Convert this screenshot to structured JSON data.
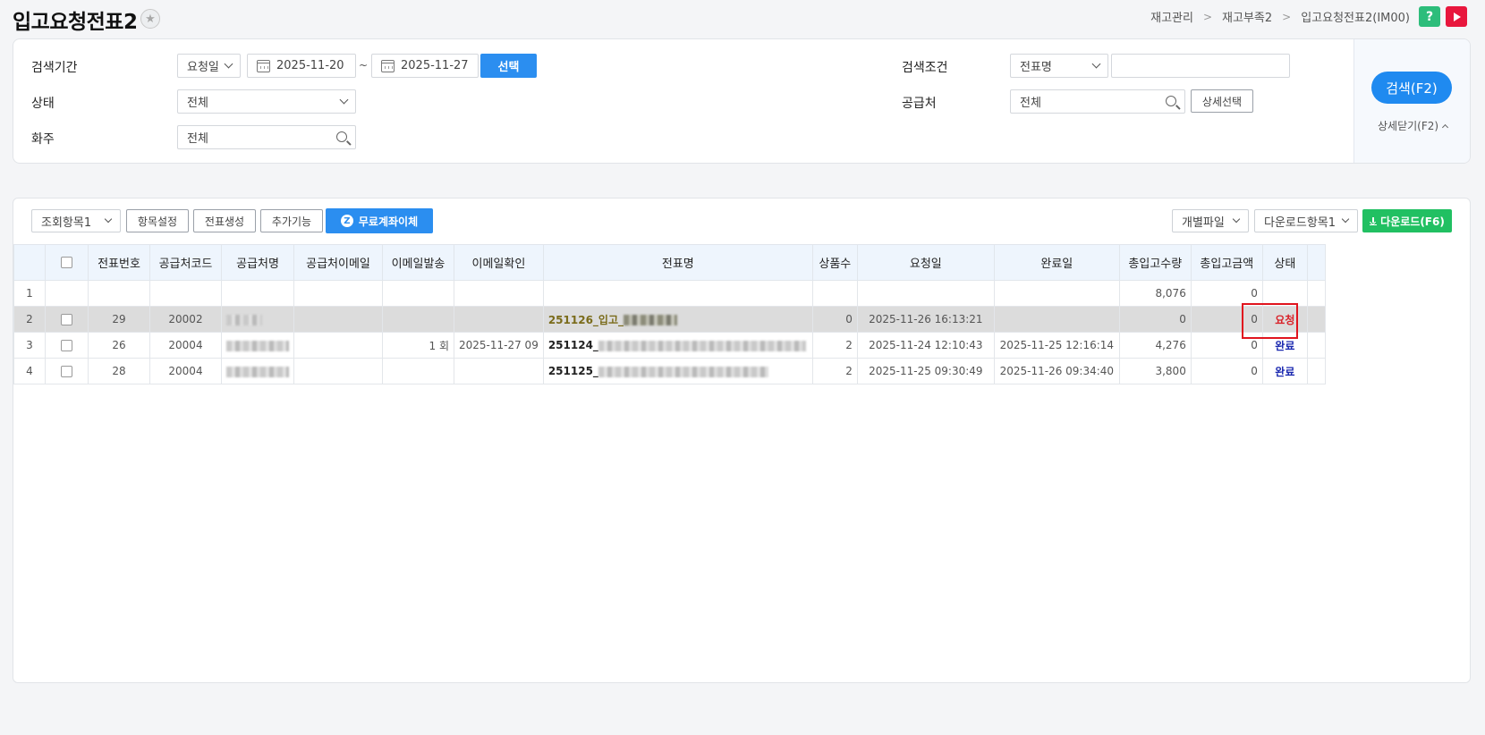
{
  "header": {
    "title": "입고요청전표2",
    "breadcrumb": [
      "재고관리",
      "재고부족2",
      "입고요청전표2(IM00)"
    ],
    "help_label": "?"
  },
  "search": {
    "period_label": "검색기간",
    "period_type": "요청일",
    "date_from": "2025-11-20",
    "date_sep": "~",
    "date_to": "2025-11-27",
    "select_btn": "선택",
    "status_label": "상태",
    "status_value": "전체",
    "owner_label": "화주",
    "owner_placeholder": "전체",
    "condition_label": "검색조건",
    "condition_type": "전표명",
    "condition_value": "",
    "supplier_label": "공급처",
    "supplier_placeholder": "전체",
    "detail_select_btn": "상세선택",
    "search_btn": "검색(F2)",
    "collapse_link": "상세닫기(F2)"
  },
  "toolbar": {
    "view_items": "조회항목1",
    "item_settings": "항목설정",
    "create_slip": "전표생성",
    "extra_functions": "추가기능",
    "free_transfer": "무료계좌이체",
    "individual_file": "개별파일",
    "download_items": "다운로드항목1",
    "download": "다운로드(F6)"
  },
  "grid": {
    "columns": [
      "",
      "",
      "전표번호",
      "공급처코드",
      "공급처명",
      "공급처이메일",
      "이메일발송",
      "이메일확인",
      "전표명",
      "상품수",
      "요청일",
      "완료일",
      "총입고수량",
      "총입고금액",
      "상태"
    ],
    "rows": [
      {
        "no": "1",
        "slip_no": "",
        "supplier_code": "",
        "email_sent": "",
        "email_confirm": "",
        "slip_name": "",
        "item_count": "",
        "request_date": "",
        "complete_date": "",
        "total_qty": "8,076",
        "total_amount": "0",
        "status": ""
      },
      {
        "no": "2",
        "slip_no": "29",
        "supplier_code": "20002",
        "email_sent": "",
        "email_confirm": "",
        "slip_name": "251126_입고_",
        "item_count": "0",
        "request_date": "2025-11-26 16:13:21",
        "complete_date": "",
        "total_qty": "0",
        "total_amount": "0",
        "status": "요청"
      },
      {
        "no": "3",
        "slip_no": "26",
        "supplier_code": "20004",
        "email_sent": "1 회",
        "email_confirm": "2025-11-27 09",
        "slip_name": "251124_",
        "item_count": "2",
        "request_date": "2025-11-24 12:10:43",
        "complete_date": "2025-11-25 12:16:14",
        "total_qty": "4,276",
        "total_amount": "0",
        "status": "완료"
      },
      {
        "no": "4",
        "slip_no": "28",
        "supplier_code": "20004",
        "email_sent": "",
        "email_confirm": "",
        "slip_name": "251125_",
        "item_count": "2",
        "request_date": "2025-11-25 09:30:49",
        "complete_date": "2025-11-26 09:34:40",
        "total_qty": "3,800",
        "total_amount": "0",
        "status": "완료"
      }
    ]
  },
  "colors": {
    "primary_blue": "#2b8ef0",
    "download_green": "#21c062",
    "status_request": "#d8232a",
    "status_done": "#1c2ab0",
    "highlight_box": "#e0141e"
  }
}
